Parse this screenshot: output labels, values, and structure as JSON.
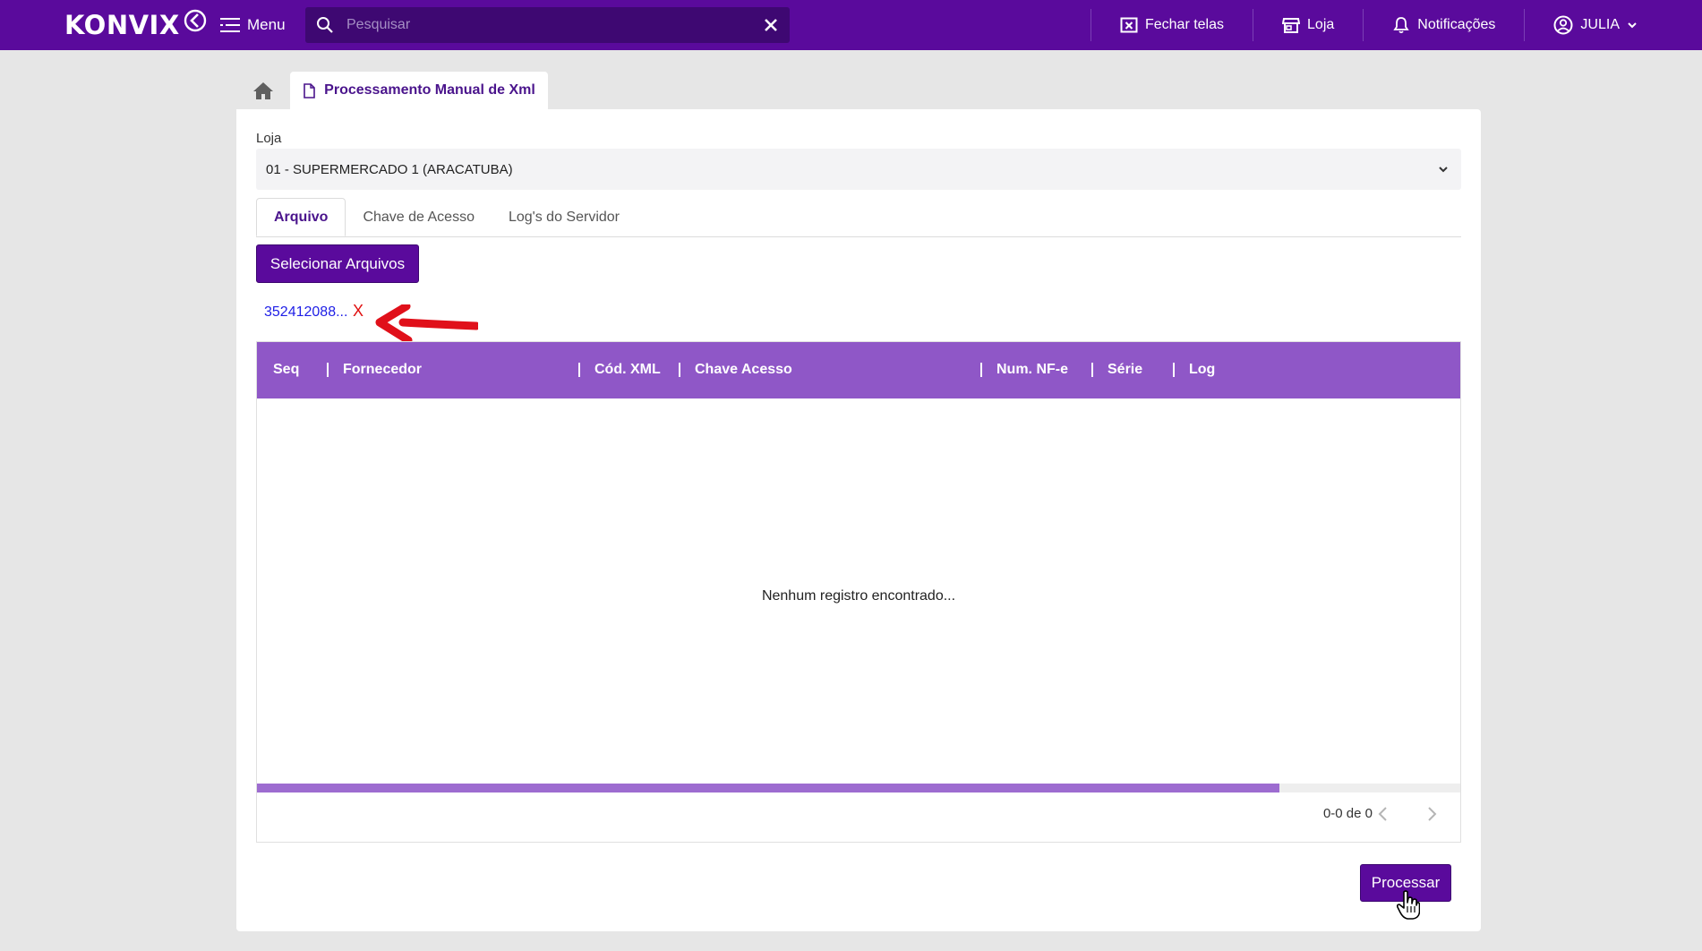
{
  "header": {
    "logo_text": "KONVIX",
    "menu_label": "Menu",
    "search_placeholder": "Pesquisar",
    "close_screens_label": "Fechar telas",
    "store_label": "Loja",
    "notifications_label": "Notificações",
    "user_label": "JULIA"
  },
  "tab": {
    "title": "Processamento Manual de Xml"
  },
  "form": {
    "store_label": "Loja",
    "store_value": "01 - SUPERMERCADO 1 (ARACATUBA)",
    "tabs": [
      {
        "label": "Arquivo",
        "active": true
      },
      {
        "label": "Chave de Acesso",
        "active": false
      },
      {
        "label": "Log's do Servidor",
        "active": false
      }
    ],
    "select_files_label": "Selecionar Arquivos",
    "selected_file": "352412088...",
    "remove_file_label": "X"
  },
  "table": {
    "columns": [
      "Seq",
      "Fornecedor",
      "Cód. XML",
      "Chave Acesso",
      "Num. NF-e",
      "Série",
      "Log"
    ],
    "empty_message": "Nenhum registro encontrado...",
    "pagination": "0-0 de 0",
    "scroll_fraction": 0.85
  },
  "actions": {
    "process_label": "Processar"
  },
  "colors": {
    "brand": "#5a0a9c",
    "header_row": "#8f57c7",
    "link": "#1e1ee6",
    "remove": "#e01010",
    "annotation_arrow": "#e0101a"
  }
}
